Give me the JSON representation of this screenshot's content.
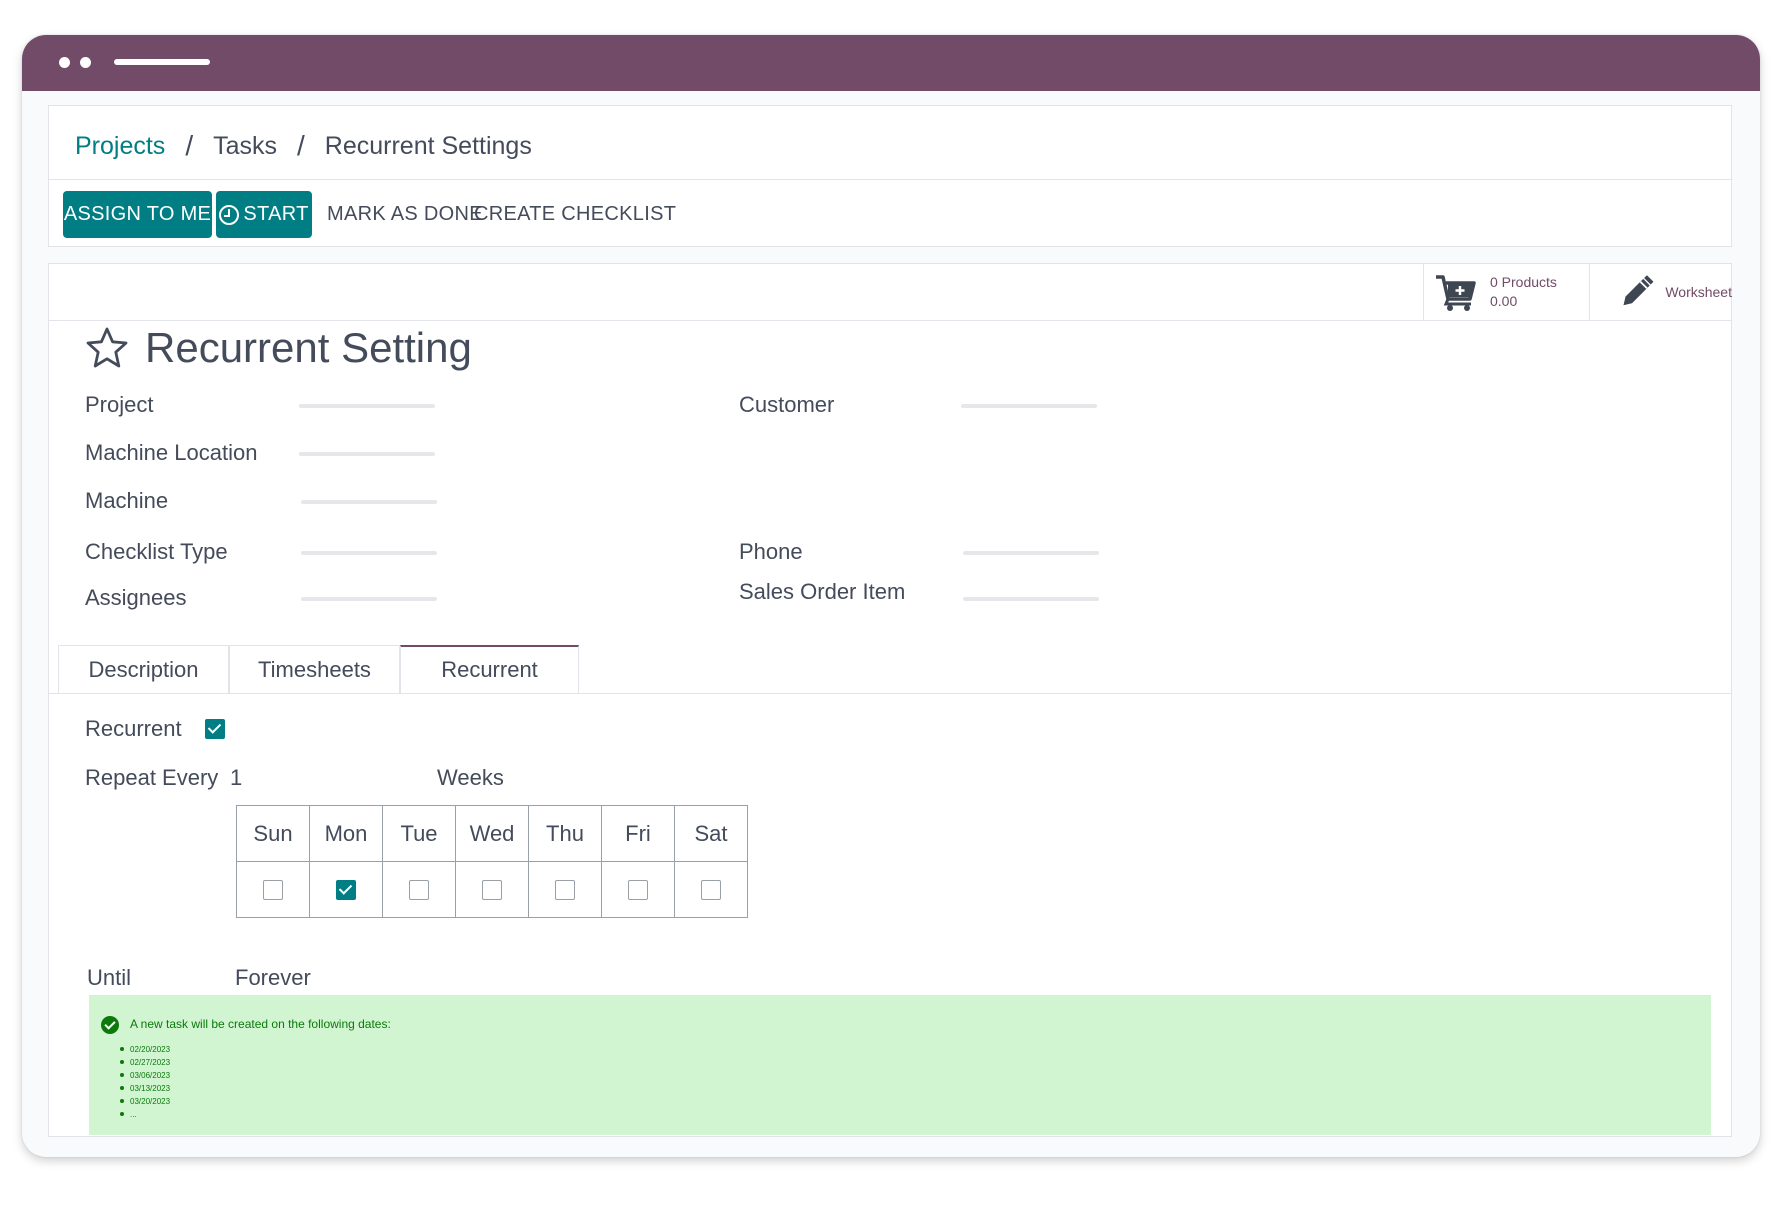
{
  "breadcrumb": {
    "items": [
      "Projects",
      "Tasks",
      "Recurrent Settings"
    ],
    "separator": "/"
  },
  "toolbar": {
    "assign_label": "ASSIGN TO ME",
    "start_label": "START",
    "mark_done_label": "MARK AS DONE",
    "create_checklist_label": "CREATE CHECKLIST"
  },
  "stat_buttons": {
    "products": {
      "count_label": "0 Products",
      "amount": "0.00",
      "icon": "cart-plus-icon"
    },
    "worksheet": {
      "label": "Worksheet",
      "icon": "pencil-icon"
    }
  },
  "record": {
    "title": "Recurrent Setting",
    "favorite_icon": "star-outline-icon"
  },
  "fields": {
    "project": "Project",
    "machine_location": "Machine Location",
    "machine": "Machine",
    "checklist_type": "Checklist Type",
    "assignees": "Assignees",
    "customer": "Customer",
    "phone": "Phone",
    "sales_order_item": "Sales Order Item"
  },
  "tabs": [
    {
      "label": "Description",
      "active": false
    },
    {
      "label": "Timesheets",
      "active": false
    },
    {
      "label": "Recurrent",
      "active": true
    }
  ],
  "recurrence": {
    "recurrent_label": "Recurrent",
    "recurrent_checked": true,
    "repeat_every_label": "Repeat Every",
    "repeat_interval": "1",
    "repeat_unit": "Weeks",
    "days": [
      {
        "label": "Sun",
        "checked": false
      },
      {
        "label": "Mon",
        "checked": true
      },
      {
        "label": "Tue",
        "checked": false
      },
      {
        "label": "Wed",
        "checked": false
      },
      {
        "label": "Thu",
        "checked": false
      },
      {
        "label": "Fri",
        "checked": false
      },
      {
        "label": "Sat",
        "checked": false
      }
    ],
    "until_label": "Until",
    "until_value": "Forever"
  },
  "notice": {
    "message": "A new task will be created on the following dates:",
    "dates": [
      "02/20/2023",
      "02/27/2023",
      "03/06/2023",
      "03/13/2023",
      "03/20/2023",
      "..."
    ]
  },
  "colors": {
    "brand": "#714b67",
    "accent": "#017e84",
    "success_bg": "#d1f4d1",
    "success_text": "#0b7a0b"
  }
}
